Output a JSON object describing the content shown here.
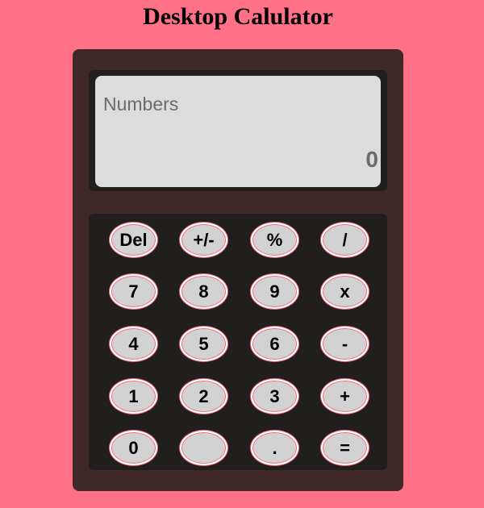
{
  "title": "Desktop Calulator",
  "display": {
    "placeholder": "Numbers",
    "value": "0"
  },
  "keys": {
    "del": "Del",
    "sign": "+/-",
    "percent": "%",
    "divide": "/",
    "seven": "7",
    "eight": "8",
    "nine": "9",
    "multiply": "x",
    "four": "4",
    "five": "5",
    "six": "6",
    "subtract": "-",
    "one": "1",
    "two": "2",
    "three": "3",
    "add": "+",
    "zero": "0",
    "blank": "",
    "decimal": ".",
    "equals": "="
  },
  "colors": {
    "page_background": "#ff7186",
    "calculator_body": "#412828",
    "panel": "#201f1e",
    "screen": "#dcdcdc",
    "key_face": "#d2d2d2",
    "key_ring": "#ee6b7c"
  }
}
